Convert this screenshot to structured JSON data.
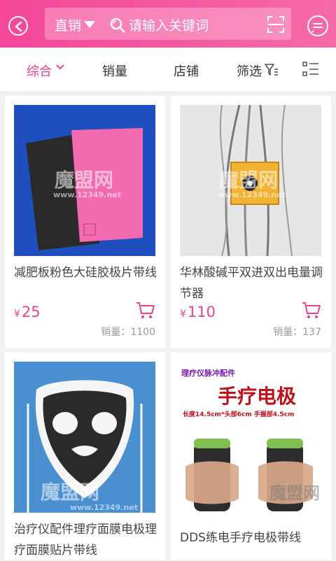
{
  "header": {
    "channel": "直销",
    "search_placeholder": "请输入关键词"
  },
  "sortbar": {
    "items": [
      {
        "label": "综合",
        "active": true
      },
      {
        "label": "销量",
        "active": false
      },
      {
        "label": "店铺",
        "active": false
      },
      {
        "label": "筛选",
        "active": false
      }
    ]
  },
  "products": [
    {
      "title": "减肥板粉色大硅胶极片带线",
      "currency": "¥",
      "price": "25",
      "sales": "销量：1100"
    },
    {
      "title": "华林酸碱平双进双出电量调节器",
      "currency": "¥",
      "price": "110",
      "sales": "销量：137"
    },
    {
      "title": "治疗仪配件理疗面膜电极理疗面膜贴片带线",
      "currency": "¥",
      "price": "",
      "sales": ""
    },
    {
      "title": "DDS练电手疗电极带线",
      "currency": "¥",
      "price": "",
      "sales": ""
    }
  ],
  "image_text": {
    "watermark": "魔盟网",
    "watermark_url": "www.12349.net",
    "product4_banner_top": "理疗仪脉冲配件",
    "product4_banner_title": "手疗电极",
    "product4_banner_spec": "长度14.5cm*头部6cm  手握部4.5cm"
  },
  "colors": {
    "accent": "#e9418e",
    "header_start": "#f4469a",
    "header_end": "#f56aa6"
  }
}
